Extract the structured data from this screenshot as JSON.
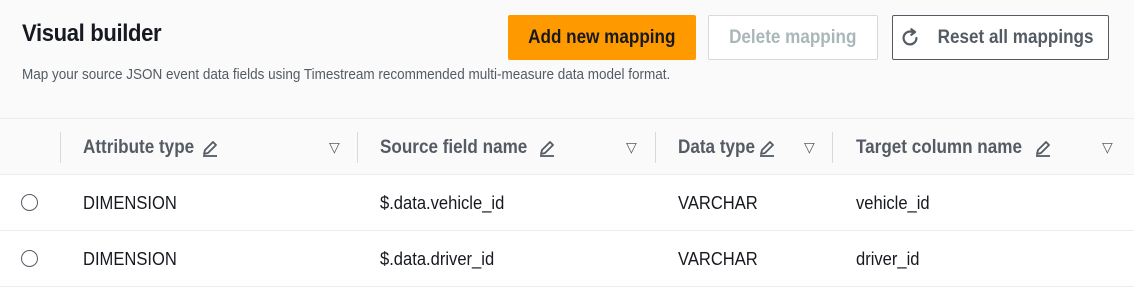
{
  "header": {
    "title": "Visual builder",
    "description": "Map your source JSON event data fields using Timestream recommended multi-measure data model format.",
    "buttons": {
      "add": "Add new mapping",
      "delete": "Delete mapping",
      "reset": "Reset all mappings"
    }
  },
  "table": {
    "columns": [
      "Attribute type",
      "Source field name",
      "Data type",
      "Target column name"
    ],
    "rows": [
      {
        "attribute_type": "DIMENSION",
        "source_field": "$.data.vehicle_id",
        "data_type": "VARCHAR",
        "target_column": "vehicle_id",
        "selected": false
      },
      {
        "attribute_type": "DIMENSION",
        "source_field": "$.data.driver_id",
        "data_type": "VARCHAR",
        "target_column": "driver_id",
        "selected": false
      }
    ]
  },
  "colors": {
    "primary": "#ff9900",
    "header_bg": "#fafafa",
    "text": "#16191f",
    "secondary_text": "#545b64",
    "disabled_text": "#aab7b8"
  },
  "icons": {
    "reset": "refresh-icon",
    "edit": "pencil-icon",
    "sort": "sort-down-triangle-icon"
  }
}
